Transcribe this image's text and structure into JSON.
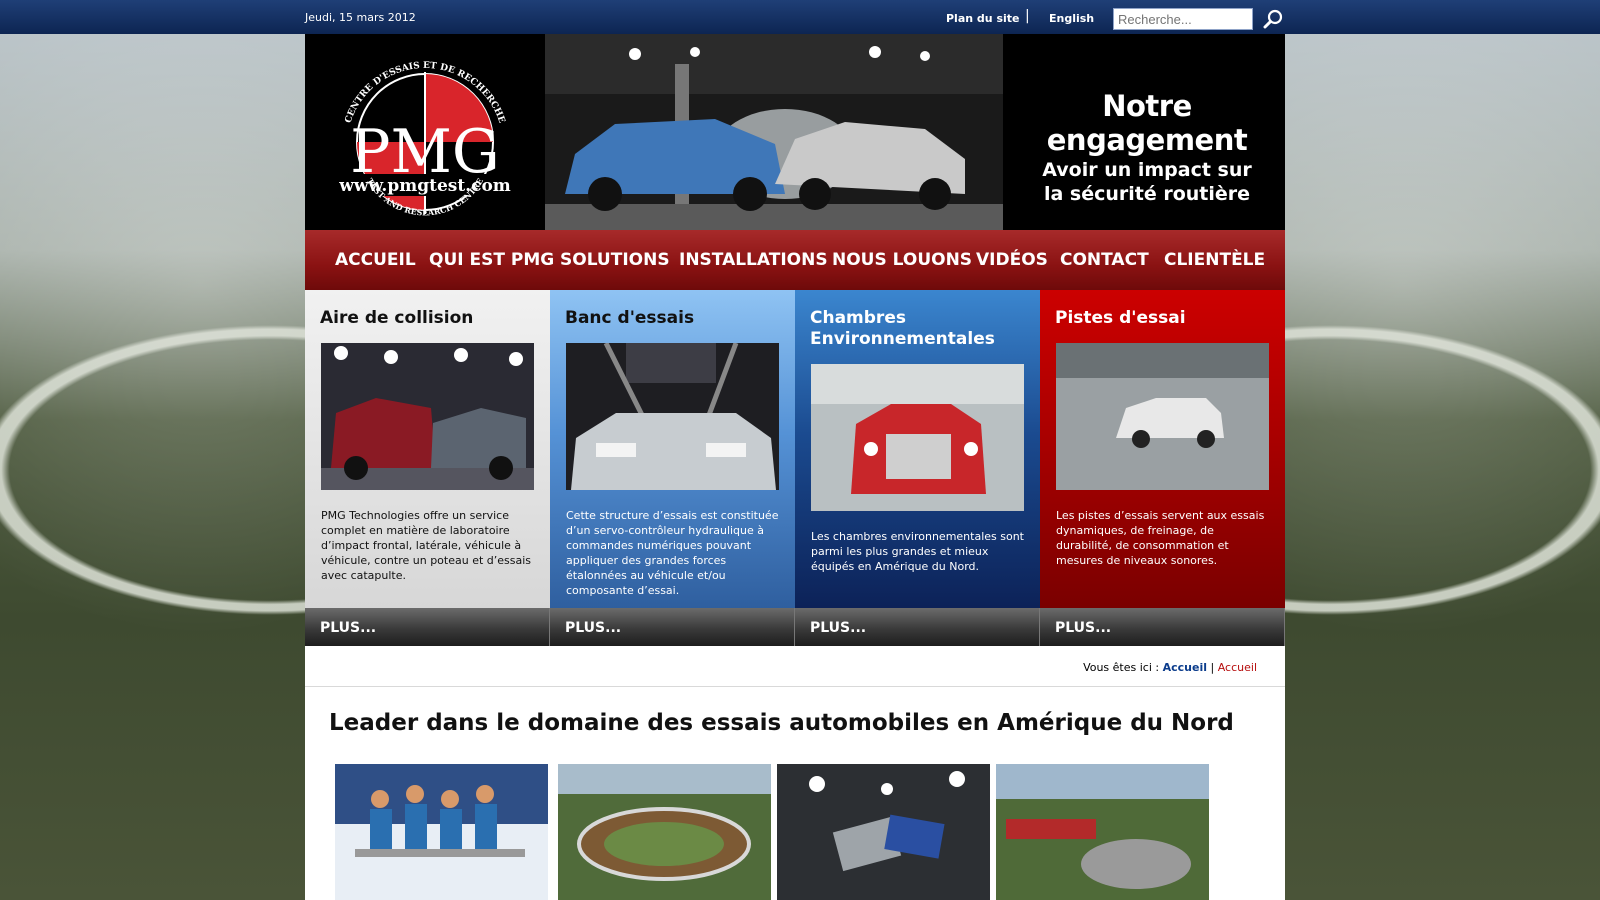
{
  "topbar": {
    "date": "Jeudi, 15 mars 2012",
    "sitemap": "Plan du site",
    "separator": "|",
    "language": "English",
    "search_placeholder": "Recherche..."
  },
  "logo": {
    "ring_top": "CENTRE D'ESSAIS ET DE RECHERCHE",
    "wordmark": "PMG",
    "url": "www.pmgtest.com",
    "ring_bottom": "TEST AND RESEARCH CENTRE"
  },
  "slogan": {
    "title": "Notre engagement",
    "line1": "Avoir un impact sur",
    "line2": "la sécurité routière"
  },
  "nav": [
    "ACCUEIL",
    "QUI EST PMG",
    "SOLUTIONS",
    "INSTALLATIONS",
    "NOUS LOUONS",
    "VIDÉOS",
    "CONTACT",
    "CLIENTÈLE"
  ],
  "columns": [
    {
      "title": "Aire de collision",
      "text": "PMG Technologies offre un service complet en matière de laboratoire d’impact frontal, latérale, véhicule à véhicule, contre un poteau et d’essais avec catapulte.",
      "more": "PLUS..."
    },
    {
      "title": "Banc d'essais",
      "text": "Cette structure d’essais est constituée d’un servo-contrôleur hydraulique à commandes numériques pouvant appliquer des grandes forces étalonnées au véhicule et/ou composante d’essai.",
      "more": "PLUS..."
    },
    {
      "title": "Chambres Environnementales",
      "text": "Les chambres environnementales sont parmi les plus grandes et mieux équipés en Amérique du Nord.",
      "more": "PLUS..."
    },
    {
      "title": "Pistes d'essai",
      "text": "Les pistes d’essais servent aux essais dynamiques, de freinage, de durabilité, de consommation et mesures de niveaux sonores.",
      "more": "PLUS..."
    }
  ],
  "breadcrumb": {
    "prefix": "Vous êtes ici :",
    "link1": "Accueil",
    "sep": "|",
    "link2": "Accueil"
  },
  "headline": "Leader dans le domaine des essais automobiles en Amérique du Nord",
  "colors": {
    "topbar": "#0d2552",
    "nav_red": "#8a1212",
    "col1": "#e4e4e4",
    "col2": "#4a86cc",
    "col3": "#12316b",
    "col4": "#a00000"
  }
}
